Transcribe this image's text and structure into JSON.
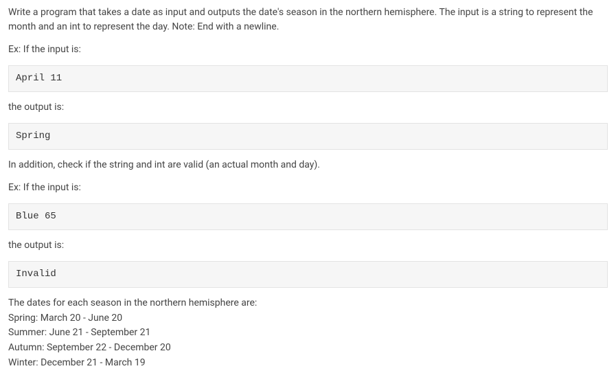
{
  "intro": "Write a program that takes a date as input and outputs the date's season in the northern hemisphere. The input is a string to represent the month and an int to represent the day. Note: End with a newline.",
  "ex1_label": "Ex: If the input is:",
  "ex1_input": "April 11",
  "ex1_output_label": "the output is:",
  "ex1_output": "Spring",
  "validation_note": "In addition, check if the string and int are valid (an actual month and day).",
  "ex2_label": "Ex: If the input is:",
  "ex2_input": "Blue 65",
  "ex2_output_label": "the output is:",
  "ex2_output": "Invalid",
  "seasons_heading": "The dates for each season in the northern hemisphere are:",
  "seasons": {
    "spring": "Spring: March 20 - June 20",
    "summer": "Summer: June 21 - September 21",
    "autumn": "Autumn: September 22 - December 20",
    "winter": "Winter: December 21 - March 19"
  }
}
